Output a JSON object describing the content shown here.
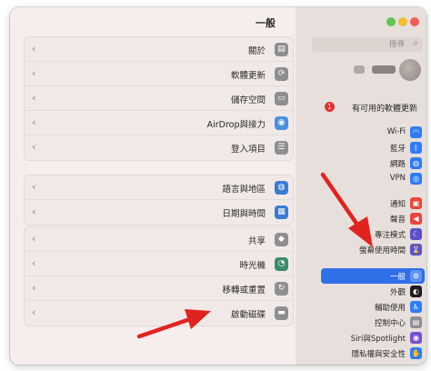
{
  "window": {
    "title": "一般",
    "traffic_lights": [
      "#ee5f57",
      "#f5bd2f",
      "#5fc454"
    ]
  },
  "content": {
    "groups": [
      {
        "items": [
          {
            "label": "關於",
            "icon": "info-icon",
            "color": "#8e8e93",
            "glyph": "▤"
          },
          {
            "label": "軟體更新",
            "icon": "gear-refresh-icon",
            "color": "#8e8e93",
            "glyph": "⟳"
          },
          {
            "label": "儲存空間",
            "icon": "storage-icon",
            "color": "#8e8e93",
            "glyph": "▭"
          },
          {
            "label": "AirDrop與接力",
            "icon": "airdrop-icon",
            "color": "#4a90e2",
            "glyph": "◉"
          },
          {
            "label": "登入項目",
            "icon": "login-items-icon",
            "color": "#8e8e93",
            "glyph": "☰"
          }
        ]
      },
      {
        "items": [
          {
            "label": "語言與地區",
            "icon": "globe-icon",
            "color": "#3a7bd5",
            "glyph": "◍"
          },
          {
            "label": "日期與時間",
            "icon": "calendar-icon",
            "color": "#3a7bd5",
            "glyph": "▦"
          }
        ]
      },
      {
        "items": [
          {
            "label": "共享",
            "icon": "sharing-icon",
            "color": "#8e8e93",
            "glyph": "◆"
          },
          {
            "label": "時光機",
            "icon": "time-machine-icon",
            "color": "#3b8d6a",
            "glyph": "◔"
          },
          {
            "label": "移轉或重置",
            "icon": "reset-icon",
            "color": "#8e8e93",
            "glyph": "↻"
          },
          {
            "label": "啟動磁碟",
            "icon": "startup-disk-icon",
            "color": "#8e8e93",
            "glyph": "▬"
          }
        ]
      }
    ]
  },
  "sidebar": {
    "search_placeholder": "搜尋",
    "software_update_label": "有可用的軟體更新",
    "software_update_badge": "1",
    "selected_color": "#2f6fe8",
    "items": [
      {
        "label": "Wi-Fi",
        "icon": "wifi-icon",
        "color": "#2f7cf6",
        "glyph": "◠"
      },
      {
        "label": "藍牙",
        "icon": "bluetooth-icon",
        "color": "#2f7cf6",
        "glyph": "ᛒ"
      },
      {
        "label": "網路",
        "icon": "network-icon",
        "color": "#2f7cf6",
        "glyph": "◍"
      },
      {
        "label": "VPN",
        "icon": "vpn-icon",
        "color": "#2f7cf6",
        "glyph": "◎"
      },
      {
        "label": "通知",
        "icon": "notifications-icon",
        "color": "#e8453c",
        "glyph": "▣"
      },
      {
        "label": "聲音",
        "icon": "sound-icon",
        "color": "#e8453c",
        "glyph": "◀"
      },
      {
        "label": "專注模式",
        "icon": "focus-icon",
        "color": "#5d4fc9",
        "glyph": "☾"
      },
      {
        "label": "螢幕使用時間",
        "icon": "screen-time-icon",
        "color": "#5d4fc9",
        "glyph": "⌛"
      },
      {
        "label": "一般",
        "icon": "general-gear-icon",
        "color": "#8e8e93",
        "glyph": "⚙",
        "selected": true
      },
      {
        "label": "外觀",
        "icon": "appearance-icon",
        "color": "#1c1c1e",
        "glyph": "◐"
      },
      {
        "label": "輔助使用",
        "icon": "accessibility-icon",
        "color": "#2f7cf6",
        "glyph": "♿"
      },
      {
        "label": "控制中心",
        "icon": "control-center-icon",
        "color": "#8e8e93",
        "glyph": "▤"
      },
      {
        "label": "Siri與Spotlight",
        "icon": "siri-icon",
        "color": "#7a4fd0",
        "glyph": "◉"
      },
      {
        "label": "隱私權與安全性",
        "icon": "privacy-hand-icon",
        "color": "#2f7cf6",
        "glyph": "✋"
      }
    ]
  }
}
